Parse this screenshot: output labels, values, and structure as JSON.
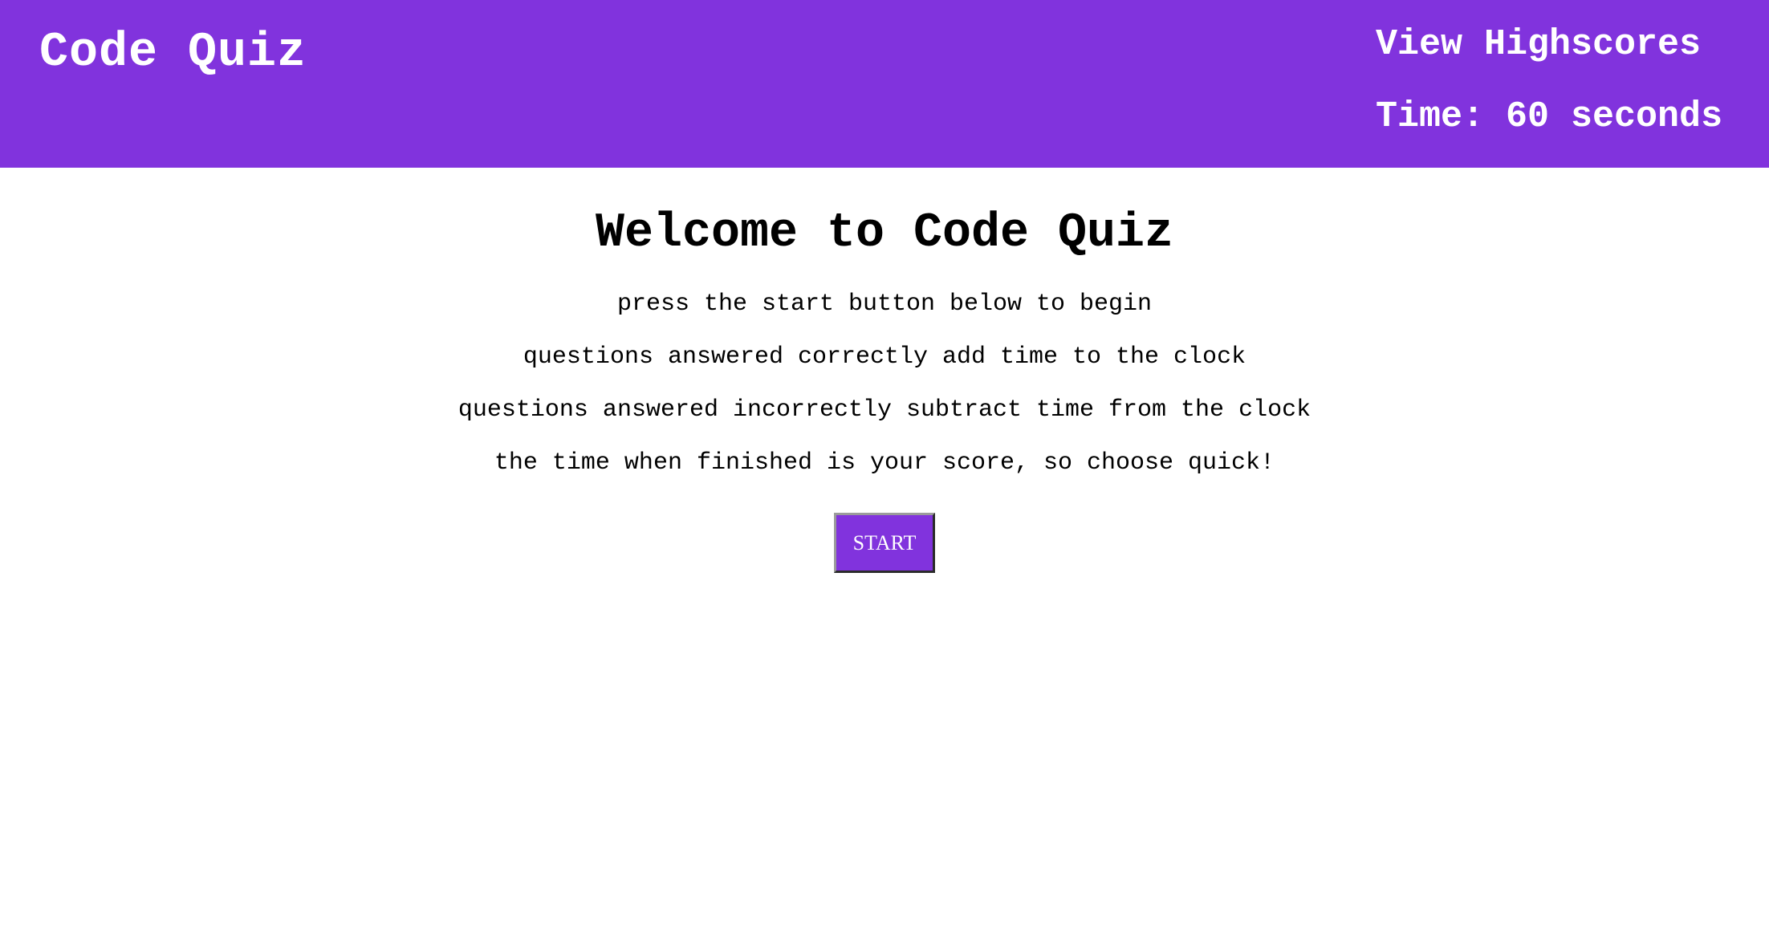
{
  "header": {
    "title": "Code Quiz",
    "highscores_label": "View Highscores",
    "timer_label": "Time: 60 seconds"
  },
  "main": {
    "title": "Welcome to Code Quiz",
    "instructions": [
      "press the start button below to begin",
      "questions answered correctly add time to the clock",
      "questions answered incorrectly subtract time from the clock",
      "the time when finished is your score, so choose quick!"
    ],
    "start_label": "START"
  },
  "colors": {
    "accent": "#8133dd",
    "header_text": "#ffffff",
    "body_text": "#000000"
  }
}
